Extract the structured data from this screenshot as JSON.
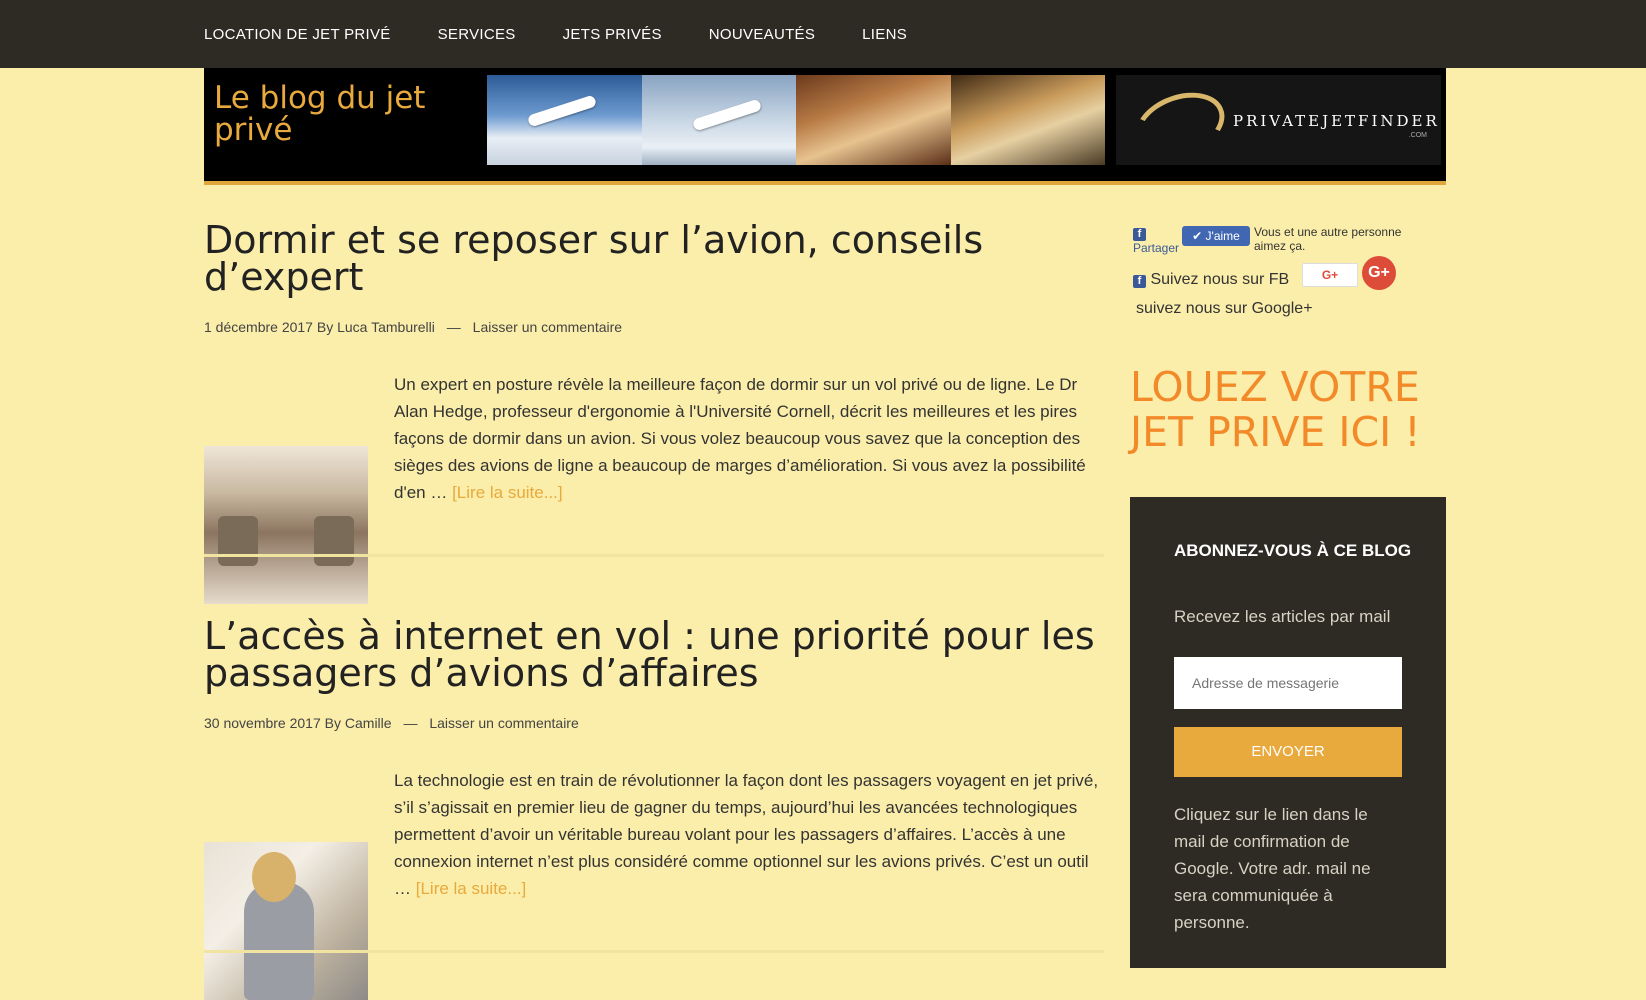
{
  "nav": {
    "items": [
      "LOCATION DE JET PRIVÉ",
      "SERVICES",
      "JETS PRIVÉS",
      "NOUVEAUTÉS",
      "LIENS"
    ]
  },
  "header": {
    "site_title": "Le blog du jet privé",
    "brand_name": "PRIVATEJETFINDER",
    "brand_sub": ".COM"
  },
  "posts": [
    {
      "title": "Dormir et se reposer sur l’avion, conseils d’expert",
      "date": "1 décembre 2017",
      "by": "By",
      "author": "Luca Tamburelli",
      "sep": "—",
      "comment": "Laisser un commentaire",
      "excerpt": "Un expert en posture révèle la meilleure façon de dormir sur un vol privé ou de ligne. Le Dr Alan Hedge, professeur d'ergonomie à l'Université Cornell, décrit les meilleures et les pires façons de dormir dans un avion. Si vous volez beaucoup vous savez que la conception des sièges des avions de ligne a beaucoup de marges d’amélioration. Si vous avez la possibilité d'en …",
      "more": "[Lire la suite...]"
    },
    {
      "title": "L’accès à internet en vol : une priorité pour les passagers d’avions d’affaires",
      "date": "30 novembre 2017",
      "by": "By",
      "author": "Camille",
      "sep": "—",
      "comment": "Laisser un commentaire",
      "excerpt": "La technologie est en train de révolutionner la façon dont les passagers voyagent en jet privé, s’il s’agissait en premier lieu de gagner du temps, aujourd’hui les avancées technologiques permettent d’avoir un véritable bureau volant pour les passagers d’affaires. L’accès à une connexion internet n’est plus considéré comme optionnel sur les avions privés. C’est un outil …",
      "more": "[Lire la suite...]"
    }
  ],
  "sidebar": {
    "fb_share": "Partager",
    "like_label": "J'aime",
    "like_text": "Vous et une autre personne aimez ça.",
    "follow_fb": "Suivez nous sur FB",
    "gplus_label": "G+",
    "gplus_circle": "G+",
    "follow_g": "suivez nous sur Google+",
    "cta": "LOUEZ VOTRE JET PRIVE ICI !",
    "subscribe": {
      "title": "ABONNEZ-VOUS À CE BLOG",
      "desc": "Recevez les articles par mail",
      "placeholder": "Adresse de messagerie",
      "button": "ENVOYER",
      "note": "Cliquez sur le lien dans le mail de confirmation de Google. Votre adr. mail ne sera communiquée à personne."
    }
  },
  "colors": {
    "background": "#fbeeaa",
    "nav": "#2e2a24",
    "accent": "#e8a93d",
    "cta": "#f28a2a"
  }
}
